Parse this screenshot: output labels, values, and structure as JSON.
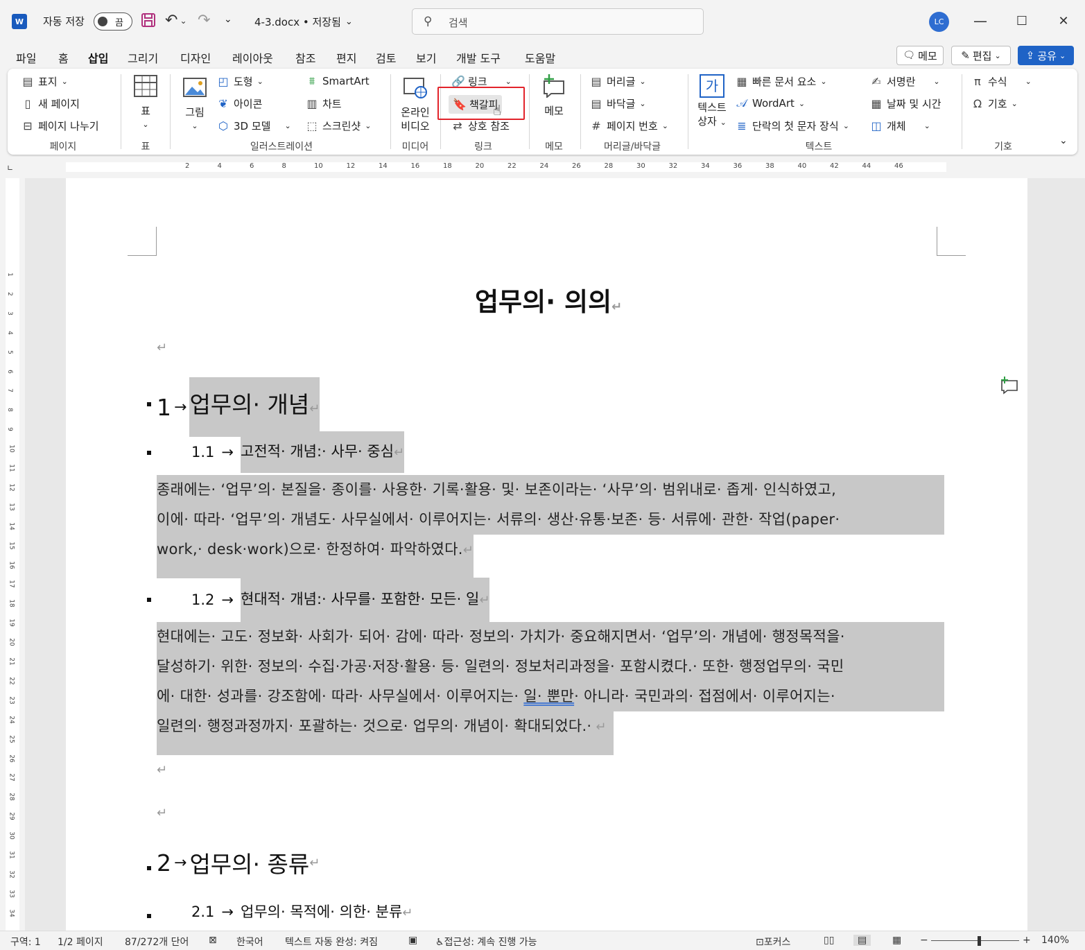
{
  "titlebar": {
    "app_icon": "W",
    "autosave_label": "자동 저장",
    "autosave_state": "끔",
    "filename": "4-3.docx • 저장됨",
    "search_placeholder": "검색",
    "avatar_initials": "LC",
    "minimize": "—",
    "maximize": "☐",
    "close": "✕"
  },
  "tabs": [
    "파일",
    "홈",
    "삽입",
    "그리기",
    "디자인",
    "레이아웃",
    "참조",
    "편지",
    "검토",
    "보기",
    "개발 도구",
    "도움말"
  ],
  "top_buttons": {
    "memo": "메모",
    "edit": "편집",
    "share": "공유"
  },
  "ribbon": {
    "page_group": {
      "label": "페이지",
      "items": [
        "표지",
        "새 페이지",
        "페이지 나누기"
      ]
    },
    "table_group": {
      "label": "표",
      "button": "표"
    },
    "illustration_group": {
      "label": "일러스트레이션",
      "picture": "그림",
      "items": [
        "도형",
        "아이콘",
        "3D 모델",
        "SmartArt",
        "차트",
        "스크린샷"
      ]
    },
    "media_group": {
      "label": "미디어",
      "button_line1": "온라인",
      "button_line2": "비디오"
    },
    "link_group": {
      "label": "링크",
      "items": [
        "링크",
        "책갈피",
        "상호 참조"
      ]
    },
    "comment_group": {
      "label": "메모",
      "button": "메모"
    },
    "header_footer_group": {
      "label": "머리글/바닥글",
      "items": [
        "머리글",
        "바닥글",
        "페이지 번호"
      ]
    },
    "text_group": {
      "label": "텍스트",
      "textbox_line1": "텍스트",
      "textbox_line2": "상자",
      "textbox_icon": "가",
      "items": [
        "빠른 문서 요소",
        "WordArt",
        "단락의 첫 문자 장식",
        "서명란",
        "날짜 및 시간",
        "개체"
      ]
    },
    "symbols_group": {
      "label": "기호",
      "items": [
        "수식",
        "기호"
      ]
    }
  },
  "ruler_numbers": [
    "2",
    "4",
    "6",
    "8",
    "10",
    "12",
    "14",
    "16",
    "18",
    "20",
    "22",
    "24",
    "26",
    "28",
    "30",
    "32",
    "34",
    "36",
    "38",
    "40",
    "42",
    "44",
    "46"
  ],
  "vruler_numbers": [
    "1",
    "2",
    "3",
    "4",
    "5",
    "6",
    "7",
    "8",
    "9",
    "10",
    "11",
    "12",
    "13",
    "14",
    "15",
    "16",
    "17",
    "18",
    "19",
    "20",
    "21",
    "22",
    "23",
    "24",
    "25",
    "26",
    "27",
    "28",
    "29",
    "30",
    "31",
    "32",
    "33",
    "34"
  ],
  "document": {
    "title": "업무의· 의의",
    "h1_1_num": "1",
    "h1_1_text": "업무의· 개념",
    "h2_1_num": "1.1",
    "h2_1_text": "고전적· 개념:· 사무· 중심",
    "p1_line1": "종래에는· ‘업무’의· 본질을· 종이를· 사용한· 기록·활용· 및· 보존이라는· ‘사무’의· 범위내로· 좁게· 인식하였고,",
    "p1_line2": "이에· 따라· ‘업무’의· 개념도· 사무실에서· 이루어지는· 서류의· 생산·유통·보존· 등· 서류에· 관한· 작업(paper·",
    "p1_line3": "work,· desk·work)으로· 한정하여· 파악하였다.",
    "h2_2_num": "1.2",
    "h2_2_text": "현대적· 개념:· 사무를· 포함한· 모든· 일",
    "p2_line1": "현대에는· 고도· 정보화· 사회가· 되어· 감에· 따라· 정보의· 가치가· 중요해지면서· ‘업무’의· 개념에· 행정목적을·",
    "p2_line2": "달성하기· 위한· 정보의· 수집·가공·저장·활용· 등· 일련의· 정보처리과정을· 포함시켰다.· 또한· 행정업무의· 국민",
    "p2_line3_a": "에· 대한· 성과를· 강조함에· 따라· 사무실에서· 이루어지는· ",
    "p2_line3_b": "일· 뿐만",
    "p2_line3_c": "· 아니라· 국민과의· 접점에서· 이루어지는·",
    "p2_line4": "일련의· 행정과정까지· 포괄하는· 것으로· 업무의· 개념이· 확대되었다.·",
    "h1_2_num": "2",
    "h1_2_text": "업무의· 종류",
    "h2_3_num": "2.1",
    "h2_3_text": "업무의· 목적에· 의한· 분류"
  },
  "statusbar": {
    "section": "구역: 1",
    "page": "1/2 페이지",
    "words": "87/272개 단어",
    "language": "한국어",
    "autocomplete": "텍스트 자동 완성: 켜짐",
    "accessibility": "접근성: 계속 진행 가능",
    "focus": "포커스",
    "zoom": "140%"
  },
  "colors": {
    "accent": "#185abd",
    "highlight_box": "#e2232b",
    "selection": "#c8c8c8",
    "share": "#1f63c6"
  }
}
